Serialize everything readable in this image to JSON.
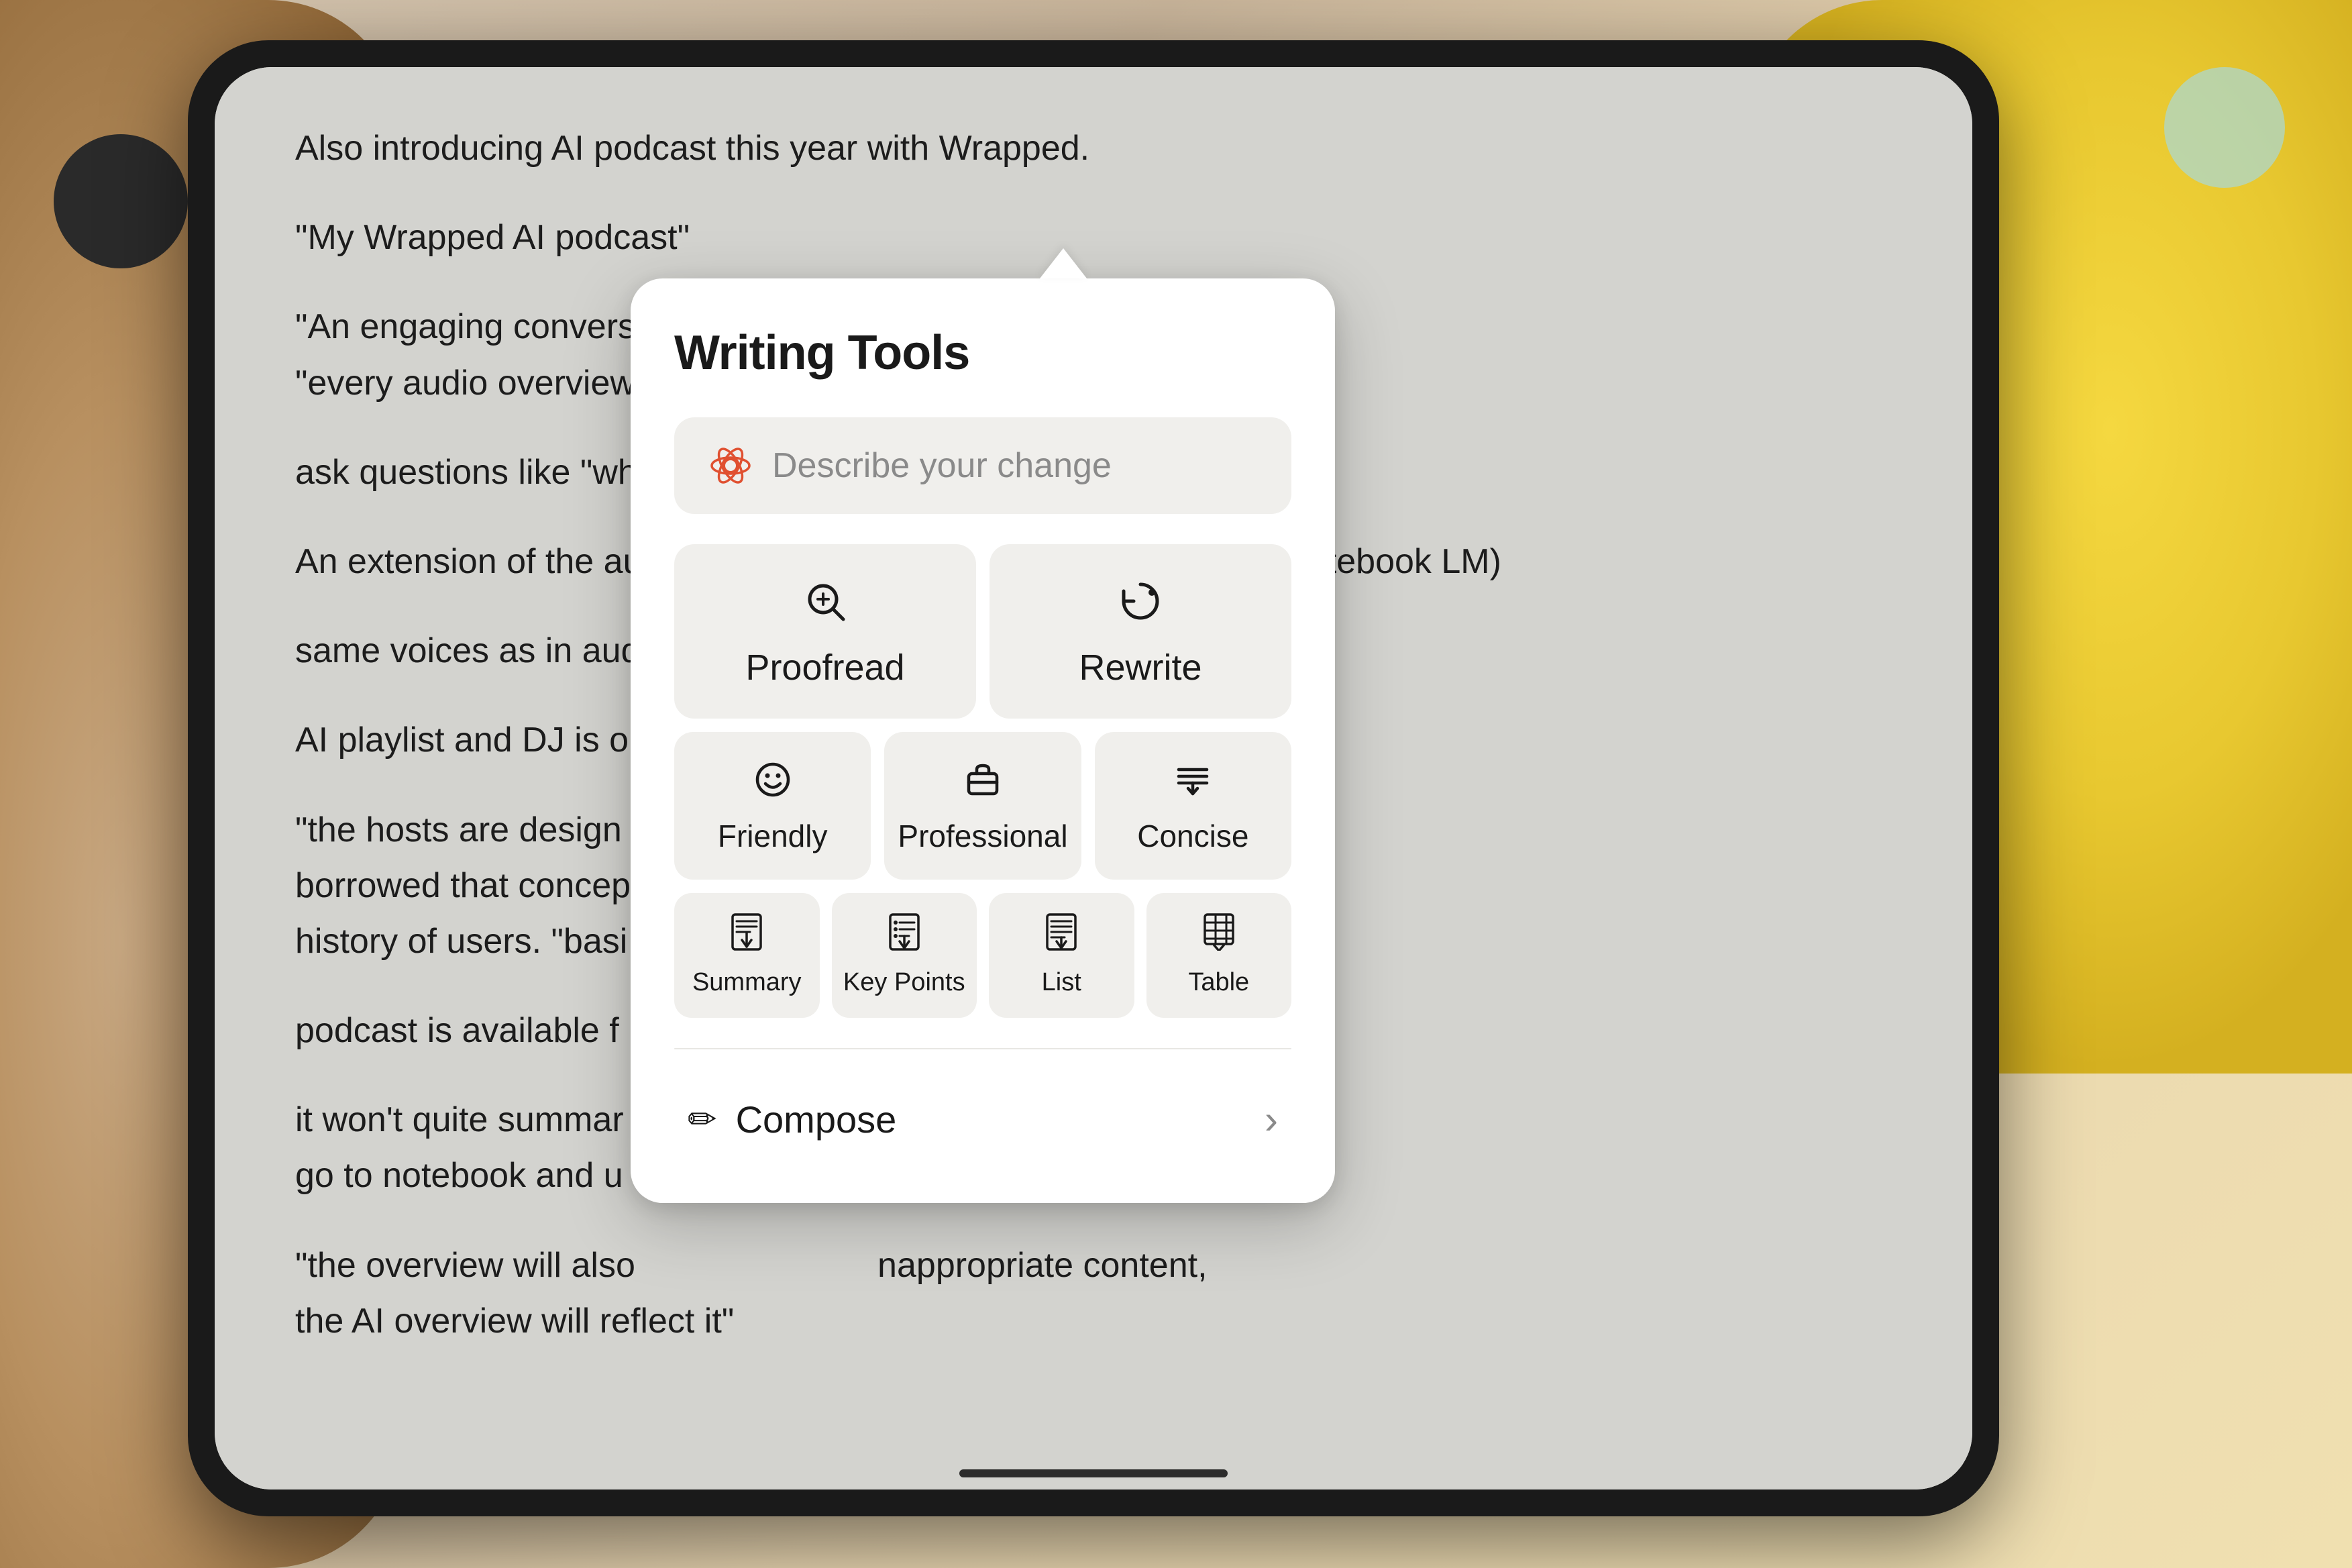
{
  "scene": {
    "background": "#c8b8a2"
  },
  "document": {
    "lines": [
      "Also introducing AI podcast this year with Wrapped.",
      "\"My Wrapped AI podcast\"",
      "\"An engaging conversation between two AI generated hosts\"",
      "\"every audio overview is one of a kind\" — google folk",
      "ask questions like \"what was the most listened to day , this year\"=",
      "An extension of the audio overviews feature from google AI / (or notebook LM)",
      "same voices as in audio overviews",
      "AI playlist and DJ is o",
      "\"the hosts are design        s of information.",
      "borrowed that concep        he princiiple for music",
      "history of users. \"basi",
      "podcast is available f",
      "it won't quite summar        for that you need to",
      "go to notebook and u",
      "\"the overview will also        nappropriate content,",
      "the AI overview will reflect it\""
    ]
  },
  "popup": {
    "title": "Writing Tools",
    "describe_placeholder": "Describe your change",
    "tools_row1": [
      {
        "id": "proofread",
        "label": "Proofread",
        "icon_type": "search-loop"
      },
      {
        "id": "rewrite",
        "label": "Rewrite",
        "icon_type": "rotate-arrow"
      }
    ],
    "tools_row2": [
      {
        "id": "friendly",
        "label": "Friendly",
        "icon_type": "smiley"
      },
      {
        "id": "professional",
        "label": "Professional",
        "icon_type": "briefcase"
      },
      {
        "id": "concise",
        "label": "Concise",
        "icon_type": "lines-arrows"
      }
    ],
    "tools_row3": [
      {
        "id": "summary",
        "label": "Summary",
        "icon_type": "doc-arrow"
      },
      {
        "id": "key-points",
        "label": "Key Points",
        "icon_type": "doc-arrow"
      },
      {
        "id": "list",
        "label": "List",
        "icon_type": "list-arrow"
      },
      {
        "id": "table",
        "label": "Table",
        "icon_type": "table-arrow"
      }
    ],
    "compose_label": "Compose",
    "compose_chevron": "›"
  }
}
